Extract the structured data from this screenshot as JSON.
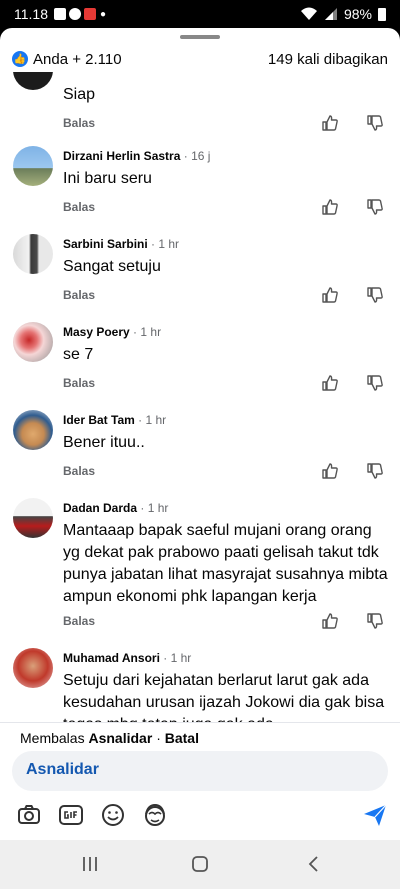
{
  "status": {
    "time": "11.18",
    "battery": "98%"
  },
  "header": {
    "reactions": "Anda + 2.110",
    "shares": "149 kali dibagikan"
  },
  "comments": [
    {
      "name": "",
      "time": "",
      "text": "Siap",
      "reply": "Balas"
    },
    {
      "name": "Dirzani Herlin Sastra",
      "time": "16 j",
      "text": "Ini baru seru",
      "reply": "Balas"
    },
    {
      "name": "Sarbini Sarbini",
      "time": "1 hr",
      "text": "Sangat setuju",
      "reply": "Balas"
    },
    {
      "name": "Masy Poery",
      "time": "1 hr",
      "text": "se 7",
      "reply": "Balas"
    },
    {
      "name": "Ider Bat Tam",
      "time": "1 hr",
      "text": "Bener ituu..",
      "reply": "Balas"
    },
    {
      "name": "Dadan Darda",
      "time": "1 hr",
      "text": "Mantaaap bapak saeful mujani orang orang yg dekat pak prabowo paati gelisah takut tdk punya jabatan lihat masyrajat susahnya mibta ampun ekonomi phk lapangan kerja",
      "reply": "Balas"
    },
    {
      "name": "Muhamad Ansori",
      "time": "1 hr",
      "text": "Setuju dari kejahatan berlarut larut gak ada kesudahan urusan ijazah Jokowi dia gak bisa tegas mbg tetap juga gak ada",
      "reply": ""
    }
  ],
  "replying": {
    "prefix": "Membalas",
    "target": "Asnalidar",
    "separator": "·",
    "cancel": "Batal"
  },
  "composer": {
    "value": "Asnalidar"
  }
}
